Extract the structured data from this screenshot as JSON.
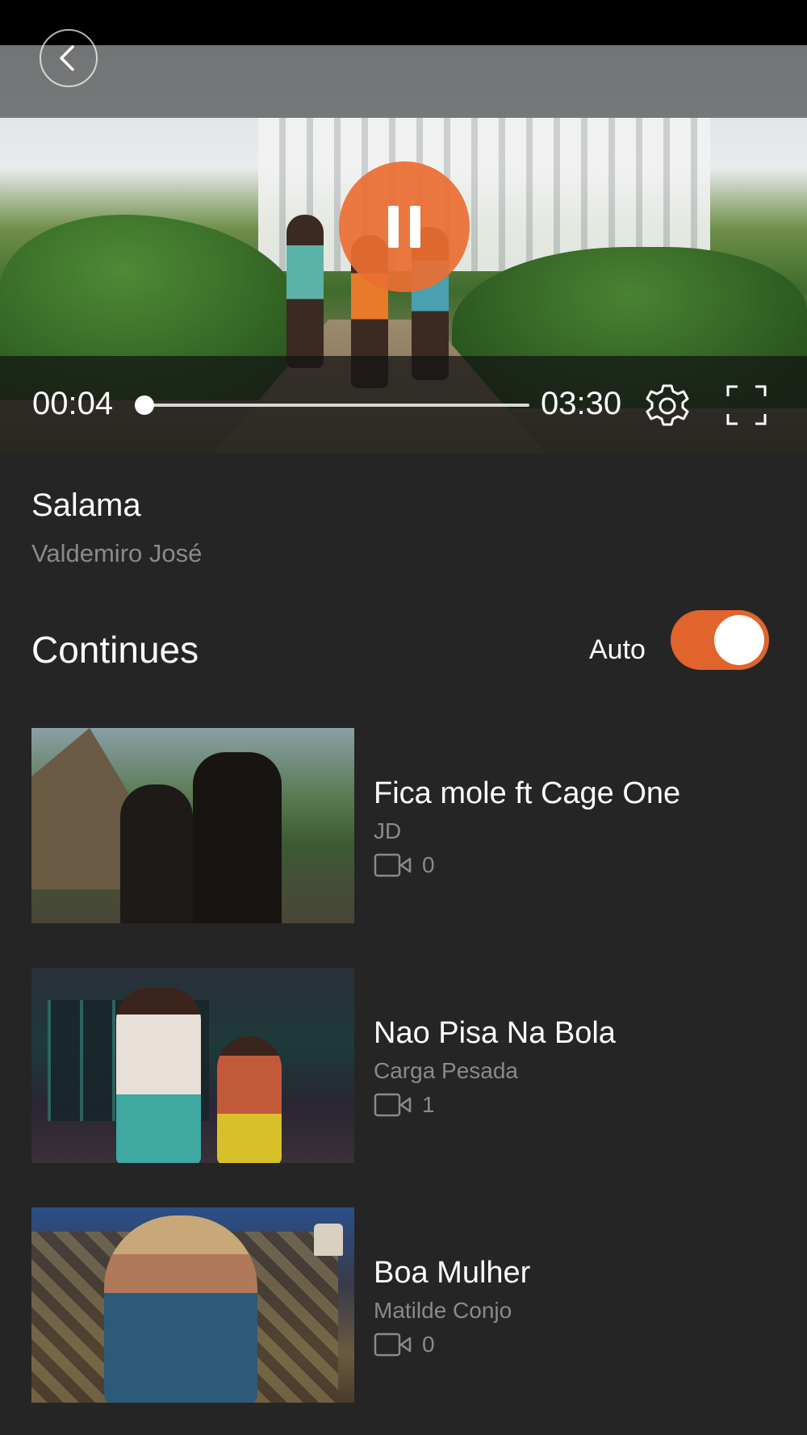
{
  "player": {
    "current_time": "00:04",
    "duration": "03:30",
    "progress_fraction": 0.019,
    "state": "playing"
  },
  "song": {
    "title": "Salama",
    "artist": "Valdemiro José"
  },
  "continues": {
    "title": "Continues",
    "auto_label": "Auto",
    "auto_enabled": true
  },
  "items": [
    {
      "title": "Fica mole ft Cage One",
      "artist": "JD",
      "count": "0"
    },
    {
      "title": "Nao Pisa Na Bola",
      "artist": "Carga Pesada",
      "count": "1"
    },
    {
      "title": "Boa Mulher",
      "artist": "Matilde Conjo",
      "count": "0"
    }
  ],
  "colors": {
    "accent": "#e0642c",
    "background": "#252525",
    "secondary_text": "#8a8a8a"
  },
  "icons": [
    "back-icon",
    "pause-icon",
    "settings-icon",
    "fullscreen-icon",
    "video-icon"
  ]
}
